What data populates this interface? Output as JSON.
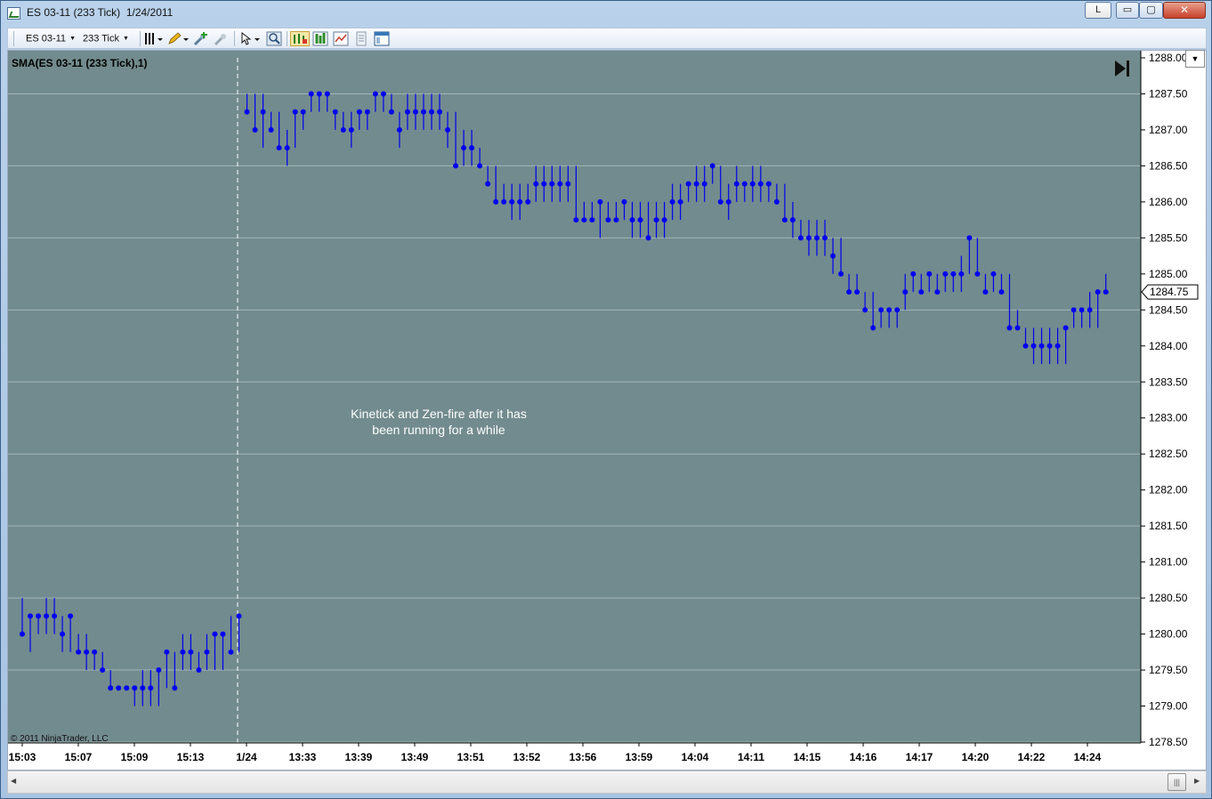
{
  "window": {
    "title": "ES 03-11 (233 Tick)  1/24/2011",
    "link_button": "L",
    "minimize_glyph": "▭",
    "maximize_glyph": "▢",
    "close_glyph": "✕"
  },
  "toolbar": {
    "instrument": "ES 03-11",
    "interval": "233 Tick",
    "icons": [
      "bar-type-icon",
      "pencil-draw-icon",
      "add-indicator-icon",
      "remove-indicator-icon",
      "cursor-icon",
      "zoom-icon",
      "strategy-icon",
      "chart-style-icon",
      "properties-icon",
      "data-box-icon",
      "panel-icon"
    ]
  },
  "chart": {
    "indicator_label": "SMA(ES 03-11 (233 Tick),1)",
    "annotation_line1": "Kinetick and Zen-fire after it has",
    "annotation_line2": "been running for a while",
    "copyright": "© 2011 NinjaTrader, LLC",
    "current_price_label": "1284.75",
    "colors": {
      "background": "#728b8e",
      "grid": "#a3b5b7",
      "series": "#0000ee",
      "text_light": "#ffffff",
      "axis_text": "#000000"
    }
  },
  "chart_data": {
    "type": "scatter",
    "title": "SMA(ES 03-11 (233 Tick),1)",
    "ylim": [
      1278.5,
      1288.0
    ],
    "y_ticks": [
      "1288.00",
      "1287.50",
      "1287.00",
      "1286.50",
      "1286.00",
      "1285.50",
      "1285.00",
      "1284.50",
      "1284.00",
      "1283.50",
      "1283.00",
      "1282.50",
      "1282.00",
      "1281.50",
      "1281.00",
      "1280.50",
      "1280.00",
      "1279.50",
      "1279.00",
      "1278.50"
    ],
    "x_ticks": [
      "15:03",
      "15:07",
      "15:09",
      "15:13",
      "1/24",
      "13:33",
      "13:39",
      "13:49",
      "13:51",
      "13:52",
      "13:56",
      "13:59",
      "14:04",
      "14:11",
      "14:15",
      "14:16",
      "14:17",
      "14:20",
      "14:22",
      "14:24"
    ],
    "session_break_label": "1/24",
    "last_price": 1284.75,
    "series": [
      {
        "points": [
          [
            1280.0,
            1280.0,
            1280.5
          ],
          [
            1280.25,
            1279.75,
            1280.25
          ],
          [
            1280.25,
            1280.0,
            1280.25
          ],
          [
            1280.25,
            1280.0,
            1280.5
          ],
          [
            1280.25,
            1280.0,
            1280.5
          ],
          [
            1280.0,
            1279.75,
            1280.25
          ],
          [
            1280.25,
            1279.75,
            1280.25
          ],
          [
            1279.75,
            1279.75,
            1280.0
          ],
          [
            1279.75,
            1279.5,
            1280.0
          ],
          [
            1279.75,
            1279.5,
            1279.75
          ],
          [
            1279.5,
            1279.5,
            1279.75
          ],
          [
            1279.25,
            1279.25,
            1279.5
          ],
          [
            1279.25,
            1279.25,
            1279.25
          ],
          [
            1279.25,
            1279.25,
            1279.25
          ],
          [
            1279.25,
            1279.0,
            1279.25
          ],
          [
            1279.25,
            1279.0,
            1279.5
          ],
          [
            1279.25,
            1279.0,
            1279.5
          ],
          [
            1279.5,
            1279.0,
            1279.5
          ],
          [
            1279.75,
            1279.25,
            1279.75
          ],
          [
            1279.25,
            1279.25,
            1279.75
          ],
          [
            1279.75,
            1279.5,
            1280.0
          ],
          [
            1279.75,
            1279.5,
            1280.0
          ],
          [
            1279.5,
            1279.5,
            1279.75
          ],
          [
            1279.75,
            1279.5,
            1280.0
          ],
          [
            1280.0,
            1279.5,
            1280.0
          ],
          [
            1280.0,
            1279.5,
            1280.0
          ],
          [
            1279.75,
            1279.75,
            1280.25
          ],
          [
            1280.25,
            1279.75,
            1280.25
          ],
          [
            1287.25,
            1287.25,
            1287.5
          ],
          [
            1287.0,
            1287.0,
            1287.5
          ],
          [
            1287.25,
            1286.75,
            1287.5
          ],
          [
            1287.0,
            1287.0,
            1287.25
          ],
          [
            1286.75,
            1286.75,
            1287.25
          ],
          [
            1286.75,
            1286.5,
            1287.0
          ],
          [
            1287.25,
            1286.75,
            1287.25
          ],
          [
            1287.25,
            1287.0,
            1287.25
          ],
          [
            1287.5,
            1287.25,
            1287.5
          ],
          [
            1287.5,
            1287.25,
            1287.5
          ],
          [
            1287.5,
            1287.25,
            1287.5
          ],
          [
            1287.25,
            1287.0,
            1287.25
          ],
          [
            1287.0,
            1287.0,
            1287.25
          ],
          [
            1287.0,
            1286.75,
            1287.25
          ],
          [
            1287.25,
            1287.0,
            1287.25
          ],
          [
            1287.25,
            1287.0,
            1287.25
          ],
          [
            1287.5,
            1287.25,
            1287.5
          ],
          [
            1287.5,
            1287.25,
            1287.5
          ],
          [
            1287.25,
            1287.25,
            1287.5
          ],
          [
            1287.0,
            1286.75,
            1287.25
          ],
          [
            1287.25,
            1287.0,
            1287.5
          ],
          [
            1287.25,
            1287.0,
            1287.5
          ],
          [
            1287.25,
            1287.0,
            1287.5
          ],
          [
            1287.25,
            1287.0,
            1287.5
          ],
          [
            1287.25,
            1287.0,
            1287.5
          ],
          [
            1287.0,
            1286.75,
            1287.25
          ],
          [
            1286.5,
            1286.5,
            1287.25
          ],
          [
            1286.75,
            1286.5,
            1287.0
          ],
          [
            1286.75,
            1286.5,
            1287.0
          ],
          [
            1286.5,
            1286.5,
            1286.75
          ],
          [
            1286.25,
            1286.25,
            1286.5
          ],
          [
            1286.0,
            1286.0,
            1286.5
          ],
          [
            1286.0,
            1286.0,
            1286.25
          ],
          [
            1286.0,
            1285.75,
            1286.25
          ],
          [
            1286.0,
            1285.75,
            1286.25
          ],
          [
            1286.0,
            1286.0,
            1286.25
          ],
          [
            1286.25,
            1286.0,
            1286.5
          ],
          [
            1286.25,
            1286.0,
            1286.5
          ],
          [
            1286.25,
            1286.0,
            1286.5
          ],
          [
            1286.25,
            1286.0,
            1286.5
          ],
          [
            1286.25,
            1286.0,
            1286.5
          ],
          [
            1285.75,
            1285.75,
            1286.5
          ],
          [
            1285.75,
            1285.75,
            1286.0
          ],
          [
            1285.75,
            1285.75,
            1286.0
          ],
          [
            1286.0,
            1285.5,
            1286.0
          ],
          [
            1285.75,
            1285.75,
            1286.0
          ],
          [
            1285.75,
            1285.75,
            1286.0
          ],
          [
            1286.0,
            1285.75,
            1286.0
          ],
          [
            1285.75,
            1285.5,
            1286.0
          ],
          [
            1285.75,
            1285.5,
            1286.0
          ],
          [
            1285.5,
            1285.5,
            1286.0
          ],
          [
            1285.75,
            1285.5,
            1286.0
          ],
          [
            1285.75,
            1285.5,
            1286.0
          ],
          [
            1286.0,
            1285.75,
            1286.25
          ],
          [
            1286.0,
            1285.75,
            1286.25
          ],
          [
            1286.25,
            1286.0,
            1286.25
          ],
          [
            1286.25,
            1286.0,
            1286.5
          ],
          [
            1286.25,
            1286.0,
            1286.5
          ],
          [
            1286.5,
            1286.25,
            1286.5
          ],
          [
            1286.0,
            1286.0,
            1286.5
          ],
          [
            1286.0,
            1285.75,
            1286.25
          ],
          [
            1286.25,
            1286.0,
            1286.5
          ],
          [
            1286.25,
            1286.0,
            1286.25
          ],
          [
            1286.25,
            1286.0,
            1286.5
          ],
          [
            1286.25,
            1286.0,
            1286.5
          ],
          [
            1286.25,
            1286.0,
            1286.25
          ],
          [
            1286.0,
            1286.0,
            1286.25
          ],
          [
            1285.75,
            1285.75,
            1286.25
          ],
          [
            1285.75,
            1285.5,
            1286.0
          ],
          [
            1285.5,
            1285.5,
            1285.75
          ],
          [
            1285.5,
            1285.25,
            1285.75
          ],
          [
            1285.5,
            1285.25,
            1285.75
          ],
          [
            1285.5,
            1285.25,
            1285.75
          ],
          [
            1285.25,
            1285.0,
            1285.5
          ],
          [
            1285.0,
            1285.0,
            1285.5
          ],
          [
            1284.75,
            1284.75,
            1285.0
          ],
          [
            1284.75,
            1284.75,
            1285.0
          ],
          [
            1284.5,
            1284.5,
            1284.75
          ],
          [
            1284.25,
            1284.25,
            1284.75
          ],
          [
            1284.5,
            1284.25,
            1284.5
          ],
          [
            1284.5,
            1284.25,
            1284.5
          ],
          [
            1284.5,
            1284.25,
            1284.5
          ],
          [
            1284.75,
            1284.5,
            1285.0
          ],
          [
            1285.0,
            1284.75,
            1285.0
          ],
          [
            1284.75,
            1284.75,
            1285.0
          ],
          [
            1285.0,
            1284.75,
            1285.0
          ],
          [
            1284.75,
            1284.75,
            1285.0
          ],
          [
            1285.0,
            1284.75,
            1285.0
          ],
          [
            1285.0,
            1284.75,
            1285.0
          ],
          [
            1285.0,
            1284.75,
            1285.25
          ],
          [
            1285.5,
            1285.0,
            1285.5
          ],
          [
            1285.0,
            1285.0,
            1285.5
          ],
          [
            1284.75,
            1284.75,
            1285.0
          ],
          [
            1285.0,
            1284.75,
            1285.0
          ],
          [
            1284.75,
            1284.75,
            1285.0
          ],
          [
            1284.25,
            1284.25,
            1285.0
          ],
          [
            1284.25,
            1284.25,
            1284.5
          ],
          [
            1284.0,
            1284.0,
            1284.25
          ],
          [
            1284.0,
            1283.75,
            1284.25
          ],
          [
            1284.0,
            1283.75,
            1284.25
          ],
          [
            1284.0,
            1283.75,
            1284.25
          ],
          [
            1284.0,
            1283.75,
            1284.25
          ],
          [
            1284.25,
            1283.75,
            1284.25
          ],
          [
            1284.5,
            1284.25,
            1284.5
          ],
          [
            1284.5,
            1284.25,
            1284.5
          ],
          [
            1284.5,
            1284.25,
            1284.75
          ],
          [
            1284.75,
            1284.25,
            1284.75
          ],
          [
            1284.75,
            1284.75,
            1285.0
          ]
        ]
      }
    ]
  },
  "scrollbar": {
    "left_glyph": "◀",
    "right_glyph": "▶",
    "thumb_glyph": "|||"
  },
  "panel_dropdown_glyph": "▼"
}
